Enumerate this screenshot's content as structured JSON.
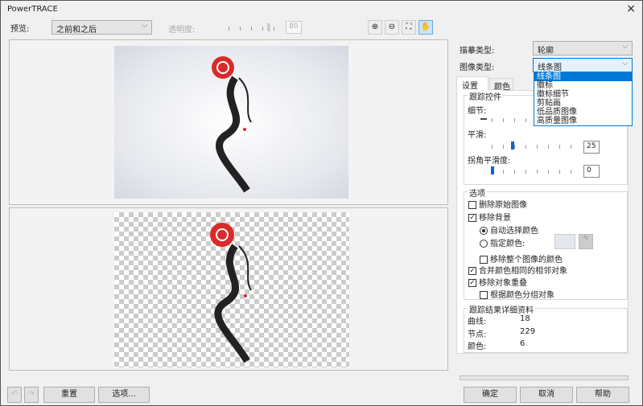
{
  "window": {
    "title": "PowerTRACE",
    "close_icon": "×"
  },
  "toolbar": {
    "preview_label": "预览:",
    "preview_value": "之前和之后",
    "transparency_label": "透明度:",
    "transparency_value": "80",
    "transparency_percent": 80
  },
  "tools": [
    {
      "name": "zoom-in-icon",
      "glyph": "⊕"
    },
    {
      "name": "zoom-out-icon",
      "glyph": "⊖"
    },
    {
      "name": "fit-icon",
      "glyph": "⛶"
    },
    {
      "name": "pan-hand-icon",
      "glyph": "✋"
    }
  ],
  "right": {
    "trace_type_label": "描摹类型:",
    "trace_type_value": "轮廓",
    "image_type_label": "图像类型:",
    "image_type_value": "线条图",
    "image_type_options": [
      "线条图",
      "徽标",
      "徽标细节",
      "剪贴画",
      "低品质图像",
      "高质量图像"
    ],
    "tabs": [
      "设置",
      "颜色"
    ],
    "trace_controls": {
      "title": "跟踪控件",
      "detail_label": "细节:",
      "smooth_label": "平滑:",
      "smooth_value": "25",
      "corner_label": "拐角平滑度:",
      "corner_value": "0"
    },
    "options": {
      "title": "选项",
      "delete_original": "删除原始图像",
      "remove_bg": "移除背景",
      "auto_color": "自动选择颜色",
      "specify_color": "指定颜色:",
      "remove_whole": "移除整个图像的颜色",
      "merge_adjacent": "合并颜色相同的相邻对象",
      "remove_overlap": "移除对象重叠",
      "group_by_color": "根据颜色分组对象"
    },
    "results": {
      "title": "跟踪结果详细资料",
      "curves_label": "曲线:",
      "curves_value": "18",
      "nodes_label": "节点:",
      "nodes_value": "229",
      "colors_label": "颜色:",
      "colors_value": "6"
    }
  },
  "bottom": {
    "undo_icon": "↶",
    "redo_icon": "↷",
    "reset": "重置",
    "options": "选项...",
    "ok": "确定",
    "cancel": "取消",
    "help": "帮助"
  }
}
